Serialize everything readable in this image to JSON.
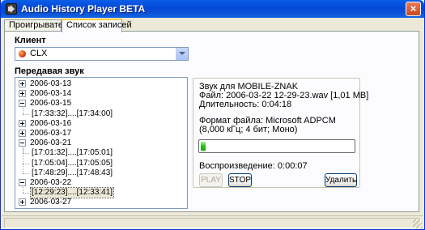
{
  "window": {
    "title": "Audio History Player BETA",
    "close_glyph": "×"
  },
  "tabs": [
    {
      "label": "Проигрыватель",
      "active": false
    },
    {
      "label": "Список записей",
      "active": true
    }
  ],
  "client": {
    "label": "Клиент",
    "selected": "CLX",
    "icon": "red-ball-icon",
    "icon_color": "#d83e10"
  },
  "tree": {
    "label": "Передавая звук",
    "items": [
      {
        "text": "2006-03-13",
        "level": 0,
        "expander": "plus"
      },
      {
        "text": "2006-03-14",
        "level": 0,
        "expander": "plus"
      },
      {
        "text": "2006-03-15",
        "level": 0,
        "expander": "minus"
      },
      {
        "text": "[17:33:32]....[17:34:00]",
        "level": 1
      },
      {
        "text": "2006-03-16",
        "level": 0,
        "expander": "plus"
      },
      {
        "text": "2006-03-17",
        "level": 0,
        "expander": "plus"
      },
      {
        "text": "2006-03-21",
        "level": 0,
        "expander": "minus"
      },
      {
        "text": "[17:01:32]....[17:05:01]",
        "level": 1
      },
      {
        "text": "[17:05:04]....[17:05:05]",
        "level": 1
      },
      {
        "text": "[17:48:29]....[17:48:43]",
        "level": 1
      },
      {
        "text": "2006-03-22",
        "level": 0,
        "expander": "minus"
      },
      {
        "text": "[12:29:23]....[12:33:41]",
        "level": 1,
        "selected": true
      },
      {
        "text": "2006-03-27",
        "level": 0,
        "expander": "plus"
      }
    ]
  },
  "details": {
    "sound_for": "Звук для MOBILE-ZNAK",
    "file": "Файл: 2006-03-22 12-29-23.wav [1,01 MB]",
    "duration": "Длительность: 0:04:18",
    "format": "Формат файла: Microsoft ADPCM",
    "format_params": "(8,000 кГц; 4 бит; Моно)",
    "progress_fraction": 0.03,
    "playback": "Воспроизведение: 0:00:07",
    "accent_green": "#2ec11d"
  },
  "buttons": {
    "play": "PLAY",
    "stop": "STOP",
    "delete": "Удалить"
  }
}
